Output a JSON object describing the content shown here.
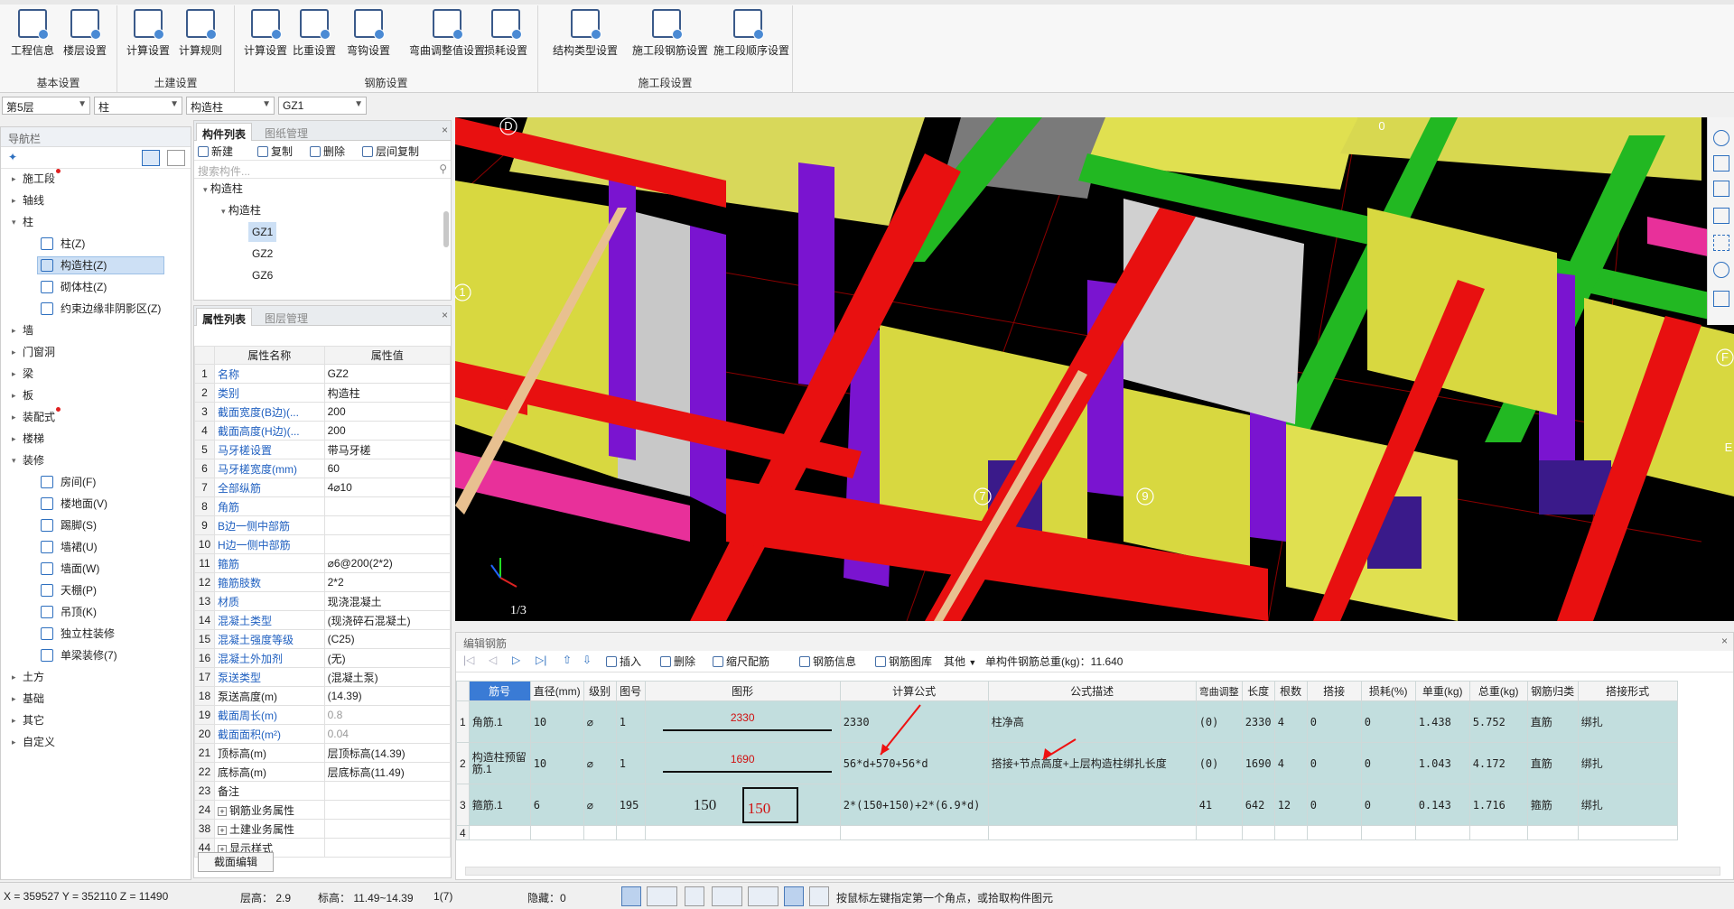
{
  "ribbon": {
    "groups": [
      {
        "label": "基本设置",
        "buttons": [
          "工程信息",
          "楼层设置"
        ]
      },
      {
        "label": "土建设置",
        "buttons": [
          "计算设置",
          "计算规则"
        ]
      },
      {
        "label": "钢筋设置",
        "buttons": [
          "计算设置",
          "比重设置",
          "弯钩设置",
          "弯曲调整值设置",
          "损耗设置"
        ]
      },
      {
        "label": "施工段设置",
        "buttons": [
          "结构类型设置",
          "施工段钢筋设置",
          "施工段顺序设置"
        ]
      }
    ]
  },
  "selectors": {
    "floor": "第5层",
    "category": "柱",
    "type": "构造柱",
    "component": "GZ1"
  },
  "nav": {
    "title": "导航栏",
    "items": [
      "施工段",
      "轴线",
      "柱",
      "柱(Z)",
      "构造柱(Z)",
      "砌体柱(Z)",
      "约束边缘非阴影区(Z)",
      "墙",
      "门窗洞",
      "梁",
      "板",
      "装配式",
      "楼梯",
      "装修",
      "房间(F)",
      "楼地面(V)",
      "踢脚(S)",
      "墙裙(U)",
      "墙面(W)",
      "天棚(P)",
      "吊顶(K)",
      "独立柱装修",
      "单梁装修(7)",
      "土方",
      "基础",
      "其它",
      "自定义"
    ]
  },
  "complist": {
    "tabs": [
      "构件列表",
      "图纸管理"
    ],
    "tools": [
      "新建",
      "复制",
      "删除",
      "层间复制"
    ],
    "search_placeholder": "搜索构件...",
    "tree": [
      "构造柱",
      "构造柱",
      "GZ1",
      "GZ2",
      "GZ6"
    ]
  },
  "props": {
    "tabs": [
      "属性列表",
      "图层管理"
    ],
    "headers": [
      "属性名称",
      "属性值"
    ],
    "rows": [
      {
        "n": "1",
        "k": "名称",
        "v": "GZ2"
      },
      {
        "n": "2",
        "k": "类别",
        "v": "构造柱"
      },
      {
        "n": "3",
        "k": "截面宽度(B边)(...",
        "v": "200"
      },
      {
        "n": "4",
        "k": "截面高度(H边)(...",
        "v": "200"
      },
      {
        "n": "5",
        "k": "马牙槎设置",
        "v": "带马牙槎"
      },
      {
        "n": "6",
        "k": "马牙槎宽度(mm)",
        "v": "60"
      },
      {
        "n": "7",
        "k": "全部纵筋",
        "v": "4⌀10"
      },
      {
        "n": "8",
        "k": "角筋",
        "v": ""
      },
      {
        "n": "9",
        "k": "B边一侧中部筋",
        "v": ""
      },
      {
        "n": "10",
        "k": "H边一侧中部筋",
        "v": ""
      },
      {
        "n": "11",
        "k": "箍筋",
        "v": "⌀6@200(2*2)"
      },
      {
        "n": "12",
        "k": "箍筋肢数",
        "v": "2*2"
      },
      {
        "n": "13",
        "k": "材质",
        "v": "现浇混凝土"
      },
      {
        "n": "14",
        "k": "混凝土类型",
        "v": "(现浇碎石混凝土)"
      },
      {
        "n": "15",
        "k": "混凝土强度等级",
        "v": "(C25)"
      },
      {
        "n": "16",
        "k": "混凝土外加剂",
        "v": "(无)"
      },
      {
        "n": "17",
        "k": "泵送类型",
        "v": "(混凝土泵)"
      },
      {
        "n": "18",
        "k": "泵送高度(m)",
        "v": "(14.39)"
      },
      {
        "n": "19",
        "k": "截面周长(m)",
        "v": "0.8"
      },
      {
        "n": "20",
        "k": "截面面积(m²)",
        "v": "0.04"
      },
      {
        "n": "21",
        "k": "顶标高(m)",
        "v": "层顶标高(14.39)"
      },
      {
        "n": "22",
        "k": "底标高(m)",
        "v": "层底标高(11.49)"
      },
      {
        "n": "23",
        "k": "备注",
        "v": ""
      },
      {
        "n": "24",
        "k": "钢筋业务属性",
        "v": ""
      },
      {
        "n": "38",
        "k": "土建业务属性",
        "v": ""
      },
      {
        "n": "44",
        "k": "显示样式",
        "v": ""
      }
    ],
    "footer_button": "截面编辑"
  },
  "viewport": {
    "axis_labels": [
      "D",
      "0",
      "1",
      "F",
      "7",
      "9",
      "E",
      "1/3"
    ]
  },
  "rebar": {
    "title": "编辑钢筋",
    "tools": [
      "插入",
      "删除",
      "缩尺配筋",
      "钢筋信息",
      "钢筋图库",
      "其他"
    ],
    "total_label": "单构件钢筋总重(kg)：11.640",
    "headers": [
      "筋号",
      "直径(mm)",
      "级别",
      "图号",
      "图形",
      "计算公式",
      "公式描述",
      "弯曲调整",
      "长度",
      "根数",
      "搭接",
      "损耗(%)",
      "单重(kg)",
      "总重(kg)",
      "钢筋归类",
      "搭接形式"
    ],
    "rows": [
      {
        "rn": "1",
        "name": "角筋.1",
        "dia": "10",
        "grade": "⌀",
        "fig": "1",
        "shape_val": "2330",
        "formula": "2330",
        "desc": "柱净高",
        "bend": "(0)",
        "len": "2330",
        "count": "4",
        "lap": "0",
        "loss": "0",
        "unit": "1.438",
        "total": "5.752",
        "cls": "直筋",
        "lapform": "绑扎"
      },
      {
        "rn": "2",
        "name": "构造柱预留筋.1",
        "dia": "10",
        "grade": "⌀",
        "fig": "1",
        "shape_val": "1690",
        "formula": "56*d+570+56*d",
        "desc": "搭接+节点高度+上层构造柱绑扎长度",
        "bend": "(0)",
        "len": "1690",
        "count": "4",
        "lap": "0",
        "loss": "0",
        "unit": "1.043",
        "total": "4.172",
        "cls": "直筋",
        "lapform": "绑扎"
      },
      {
        "rn": "3",
        "name": "箍筋.1",
        "dia": "6",
        "grade": "⌀",
        "fig": "195",
        "shape_val": "150",
        "shape_val2": "150",
        "formula": "2*(150+150)+2*(6.9*d)",
        "desc": "",
        "bend": "41",
        "len": "642",
        "count": "12",
        "lap": "0",
        "loss": "0",
        "unit": "0.143",
        "total": "1.716",
        "cls": "箍筋",
        "lapform": "绑扎"
      }
    ],
    "empty_row_num": "4"
  },
  "status": {
    "coords": "X = 359527 Y = 352110 Z = 11490",
    "floor_height": "层高： 2.9",
    "elevation": "标高： 11.49~14.39",
    "count": "1(7)",
    "hidden": "隐藏：0",
    "hint": "按鼠标左键指定第一个角点，或拾取构件图元"
  }
}
